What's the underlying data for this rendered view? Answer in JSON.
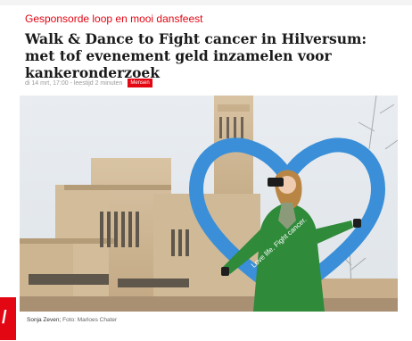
{
  "article": {
    "kicker": "Gesponsorde loop en mooi dansfeest",
    "headline": "Walk & Dance to Fight cancer in Hilversum: met tof evenement geld inzamelen voor kankeronderzoek",
    "meta": "di 14 mrt, 17:00 - leestijd 2 minuten",
    "badge": "Mensen",
    "photo": {
      "heart_text": "Love life. Fight cancer."
    },
    "caption_name": "Sonja Zeven;",
    "caption_credit": "Foto: Marloes Chater"
  },
  "colors": {
    "accent": "#e30613",
    "heart": "#3a8fd8",
    "jacket": "#2f8a3a"
  },
  "icons": {
    "logo": "brand-logo-icon"
  }
}
